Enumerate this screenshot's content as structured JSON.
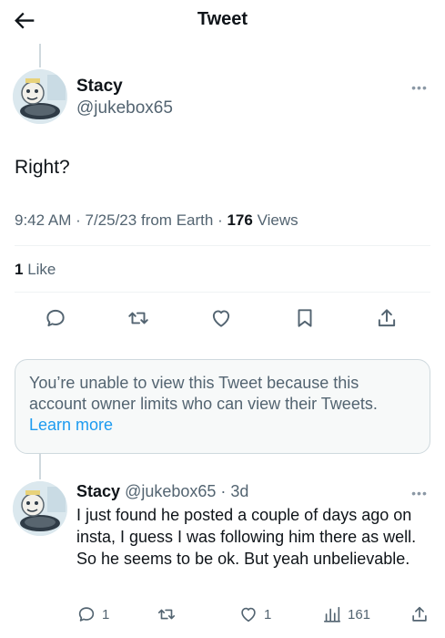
{
  "header": {
    "title": "Tweet",
    "back_icon": "arrow-left-icon"
  },
  "tweet": {
    "author_name": "Stacy",
    "author_handle": "@jukebox65",
    "text": "Right?",
    "time": "9:42 AM",
    "date": "7/25/23",
    "source": "from Earth",
    "views_count": "176",
    "views_label": "Views",
    "likes_count": "1",
    "likes_label": "Like",
    "actions": [
      "reply-icon",
      "retweet-icon",
      "like-icon",
      "bookmark-icon",
      "share-icon"
    ]
  },
  "notice": {
    "text": "You’re unable to view this Tweet because this account owner limits who can view their Tweets.",
    "link": "Learn more"
  },
  "reply": {
    "author_name": "Stacy",
    "author_handle": "@jukebox65",
    "age": "3d",
    "text": "I just found he posted a couple of days ago on insta, I guess I was following him there as well. So he seems to be ok. But yeah unbelievable.",
    "reply_count": "1",
    "like_count": "1",
    "views_count": "161"
  },
  "colors": {
    "accent": "#1d9bf0",
    "text_primary": "#0f1419",
    "text_secondary": "#536471",
    "border": "#cfd9de"
  }
}
